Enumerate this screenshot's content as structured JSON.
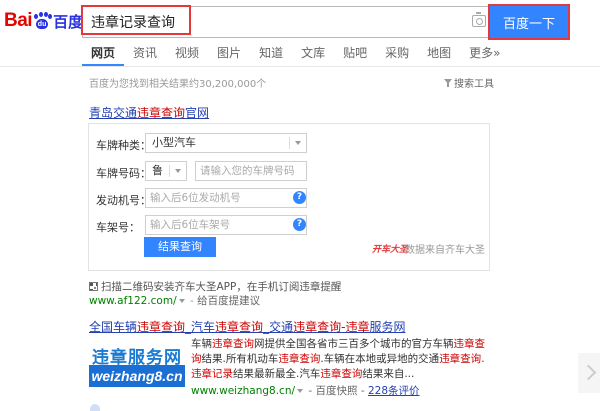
{
  "header": {
    "logo_bai": "Bai",
    "logo_du": "du",
    "logo_cn": "百度",
    "search_value": "违章记录查询",
    "search_button": "百度一下"
  },
  "nav": {
    "tabs": [
      "网页",
      "资讯",
      "视频",
      "图片",
      "知道",
      "文库",
      "贴吧",
      "采购",
      "地图",
      "更多»"
    ],
    "active": "网页"
  },
  "stats": {
    "result_count": "百度为您找到相关结果约30,200,000个",
    "tools_label": "搜索工具"
  },
  "result1": {
    "title_prefix": "青岛交通",
    "title_highlight": "违章查询",
    "title_suffix": "官网",
    "form": {
      "plate_type_label": "车牌种类：",
      "plate_type_value": "小型汽车",
      "plate_no_label": "车牌号码：",
      "plate_prefix": "鲁",
      "plate_no_placeholder": "请输入您的车牌号码",
      "engine_label": "发动机号：",
      "engine_placeholder": "输入后6位发动机号",
      "frame_label": "车架号：",
      "frame_placeholder": "输入后6位车架号",
      "submit": "结果查询",
      "help": "?",
      "brand_mark": "开车大圣",
      "brand_note": "数据来自齐车大圣"
    },
    "qr_text": "扫描二维码安装齐车大圣APP，在手机订阅违章提醒",
    "url": "www.af122.com/",
    "url_sep": " - ",
    "url_link": "给百度提建议"
  },
  "result2": {
    "title_a": "全国车辆",
    "title_h1": "违章查询",
    "title_b": "_汽车",
    "title_h2": "违章查询",
    "title_c": "_交通",
    "title_h3": "违章查询",
    "title_d": "-",
    "title_h4": "违章",
    "title_e": "服务网",
    "logo_top": "违章服务网",
    "logo_bottom": "weizhang8.cn",
    "desc_1": "车辆",
    "desc_h1": "违章查询",
    "desc_2": "网提供全国各省市三百多个城市的官方车辆",
    "desc_h2": "违章查询",
    "desc_3": "结果.所有机动车",
    "desc_h3": "违章查询",
    "desc_4": ".车辆在本地或异地的交通",
    "desc_h4": "违章查询",
    "desc_5": ".",
    "desc_h5": "违章记录",
    "desc_6": "结果最新最全.汽车",
    "desc_h6": "违章查询",
    "desc_7": "结果来自...",
    "url": "www.weizhang8.cn/",
    "url_sep": " - ",
    "snapshot": "百度快照",
    "reviews": "228条评价"
  }
}
